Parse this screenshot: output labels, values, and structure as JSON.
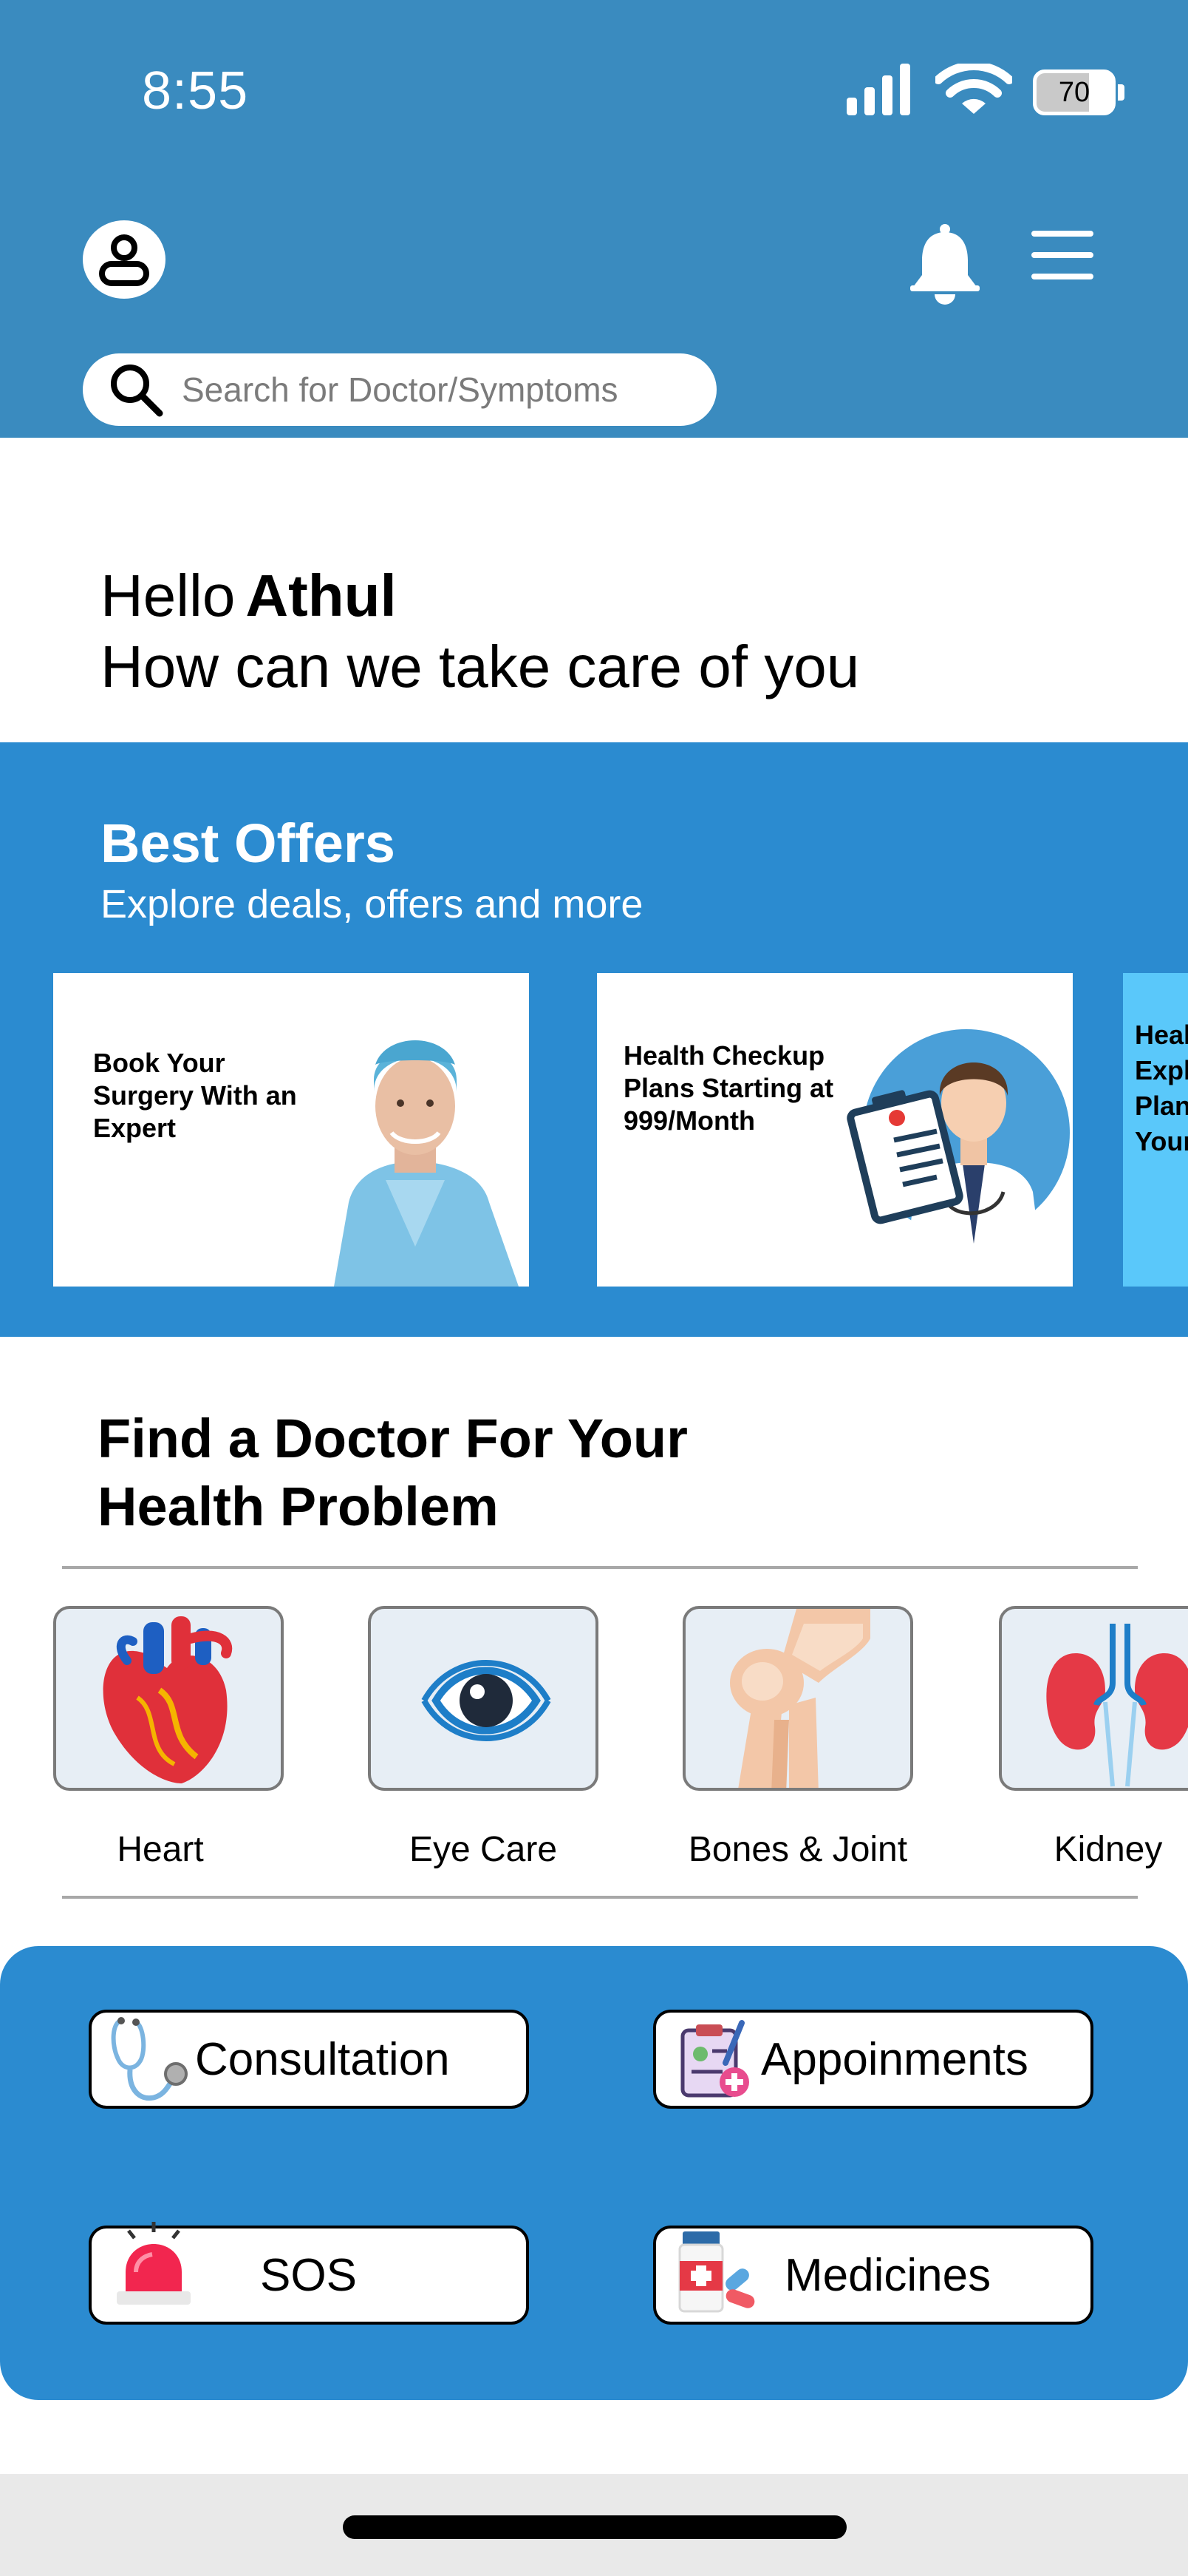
{
  "status_bar": {
    "time": "8:55",
    "battery_level": "70",
    "battery_fraction": 0.7
  },
  "header": {
    "profile_icon": "profile-icon",
    "bell_icon": "bell-icon",
    "menu_icon": "hamburger-menu-icon",
    "search_placeholder": "Search for Doctor/Symptoms",
    "background_color": "#3a8bbf"
  },
  "greeting": {
    "hello": "Hello",
    "name": "Athul",
    "subtitle": "How can we take care of you"
  },
  "offers": {
    "title": "Best Offers",
    "subtitle": "Explore deals, offers and more",
    "background_color": "#2b8bd0",
    "cards": [
      {
        "text": "Book Your Surgery With an Expert",
        "image": "surgeon-photo"
      },
      {
        "text": "Health Checkup Plans Starting at 999/Month",
        "image": "doctor-with-clipboard"
      },
      {
        "text": "Heal Expl Plan Your",
        "image": ""
      }
    ]
  },
  "find_doctor": {
    "title_line1": "Find a Doctor For Your",
    "title_line2": "Health Problem",
    "categories": [
      {
        "label": "Heart",
        "icon": "heart-icon"
      },
      {
        "label": "Eye Care",
        "icon": "eye-icon"
      },
      {
        "label": "Bones & Joint",
        "icon": "knee-joint-icon"
      },
      {
        "label": "Kidney",
        "icon": "kidney-icon"
      }
    ]
  },
  "actions": {
    "consultation": "Consultation",
    "appointments": "Appoinments",
    "sos": "SOS",
    "medicines": "Medicines"
  }
}
